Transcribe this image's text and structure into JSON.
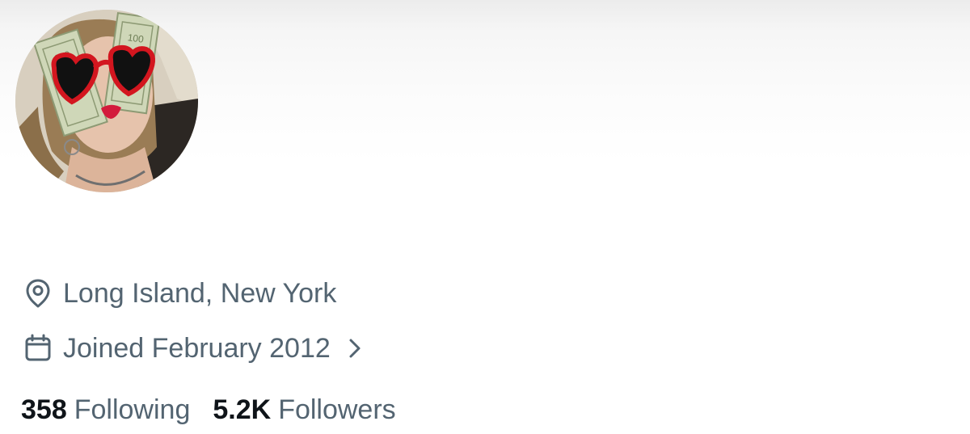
{
  "profile": {
    "avatar_icon": "profile-photo",
    "location": {
      "icon": "location-pin-icon",
      "text": "Long Island, New York"
    },
    "joined": {
      "icon": "calendar-icon",
      "text": "Joined February 2012",
      "chevron_icon": "chevron-right-icon"
    },
    "stats": {
      "following_count": "358",
      "following_label": "Following",
      "followers_count": "5.2K",
      "followers_label": "Followers"
    }
  },
  "colors": {
    "primary_text": "#0f1419",
    "secondary_text": "#536471",
    "background": "#ffffff"
  }
}
